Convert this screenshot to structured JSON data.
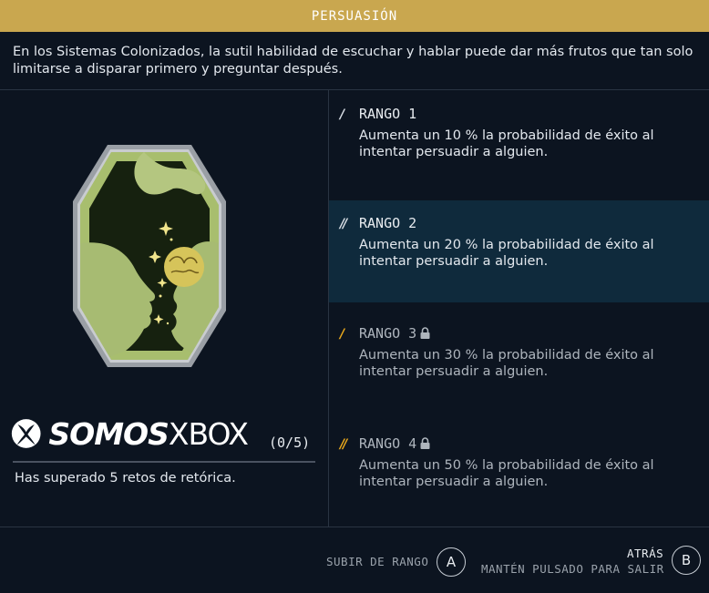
{
  "header": {
    "title": "PERSUASIÓN"
  },
  "description": "En los Sistemas Colonizados, la sutil habilidad de escuchar y hablar puede dar más frutos que tan solo limitarse a disparar primero y preguntar después.",
  "skill": {
    "progress": "(0/5)",
    "challenge": "Has superado 5 retos de retórica.",
    "watermark": {
      "part1": "SOMOS",
      "part2": "XBOX"
    }
  },
  "ranks": [
    {
      "marker": "/",
      "title": "RANGO 1",
      "text": "Aumenta un 10 % la probabilidad de éxito al intentar persuadir a alguien.",
      "locked": false,
      "active": false
    },
    {
      "marker": "//",
      "title": "RANGO 2",
      "text": "Aumenta un 20 % la probabilidad de éxito al intentar persuadir a alguien.",
      "locked": false,
      "active": true
    },
    {
      "marker": "/",
      "title": "RANGO 3",
      "text": "Aumenta un 30 % la probabilidad de éxito al intentar persuadir a alguien.",
      "locked": true,
      "active": false
    },
    {
      "marker": "//",
      "title": "RANGO 4",
      "text": "Aumenta un 50 % la probabilidad de éxito al intentar persuadir a alguien.",
      "locked": true,
      "active": false
    }
  ],
  "footer": {
    "rank_up_label": "SUBIR DE RANGO",
    "rank_up_key": "A",
    "back_label": "ATRÁS",
    "exit_label": "MANTÉN PULSADO PARA SALIR",
    "back_key": "B"
  },
  "colors": {
    "accent": "#c9a74f",
    "marker_unlocked": "#d7dde4",
    "marker_locked": "#e8a81c",
    "active_bg": "#0f2a3c"
  }
}
